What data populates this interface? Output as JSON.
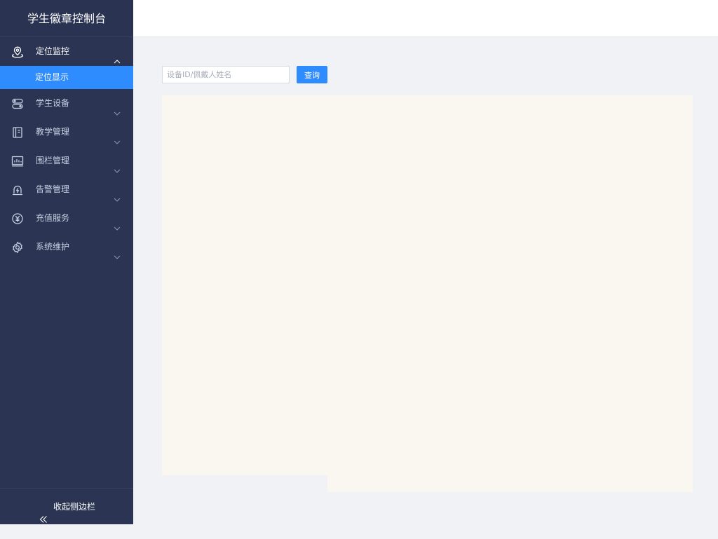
{
  "app": {
    "title": "学生徽章控制台"
  },
  "sidebar": {
    "items": [
      {
        "label": "定位监控",
        "icon": "location-pin-icon",
        "expanded": true,
        "children": [
          {
            "label": "定位显示",
            "active": true
          }
        ]
      },
      {
        "label": "学生设备",
        "icon": "device-toggle-icon",
        "expanded": false
      },
      {
        "label": "教学管理",
        "icon": "book-icon",
        "expanded": false
      },
      {
        "label": "围栏管理",
        "icon": "chart-monitor-icon",
        "expanded": false
      },
      {
        "label": "告警管理",
        "icon": "alarm-icon",
        "expanded": false
      },
      {
        "label": "充值服务",
        "icon": "yen-circle-icon",
        "expanded": false
      },
      {
        "label": "系统维护",
        "icon": "gear-icon",
        "expanded": false
      }
    ],
    "collapse_label": "收起侧边栏"
  },
  "search": {
    "placeholder": "设备ID/佩戴人姓名",
    "value": "",
    "button_label": "查询"
  },
  "colors": {
    "sidebar_bg": "#2b3553",
    "accent": "#2f8cff",
    "map_bg": "#faf7f0",
    "page_bg": "#f0f2f5"
  }
}
